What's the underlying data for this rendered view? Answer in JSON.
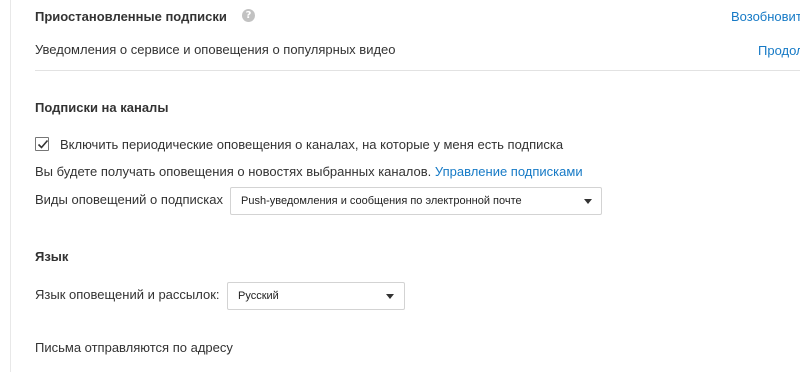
{
  "paused": {
    "title": "Приостановленные подписки",
    "resume_link": "Возобновить",
    "description": "Уведомления о сервисе и оповещения о популярных видео",
    "continue_link": "Продолжить"
  },
  "subscriptions": {
    "title": "Подписки на каналы",
    "checkbox_label": "Включить периодические оповещения о каналах, на которые у меня есть подписка",
    "checkbox_checked": true,
    "info_text": "Вы будете получать оповещения о новостях выбранных каналов.",
    "manage_link": "Управление подписками",
    "types_label": "Виды оповещений о подписках",
    "types_value": "Push-уведомления и сообщения по электронной почте"
  },
  "language": {
    "title": "Язык",
    "label": "Язык оповещений и рассылок:",
    "value": "Русский"
  },
  "footer": {
    "text": "Письма отправляются по адресу"
  },
  "colors": {
    "link": "#167ac6",
    "text": "#333333",
    "divider": "#e2e2e2"
  }
}
